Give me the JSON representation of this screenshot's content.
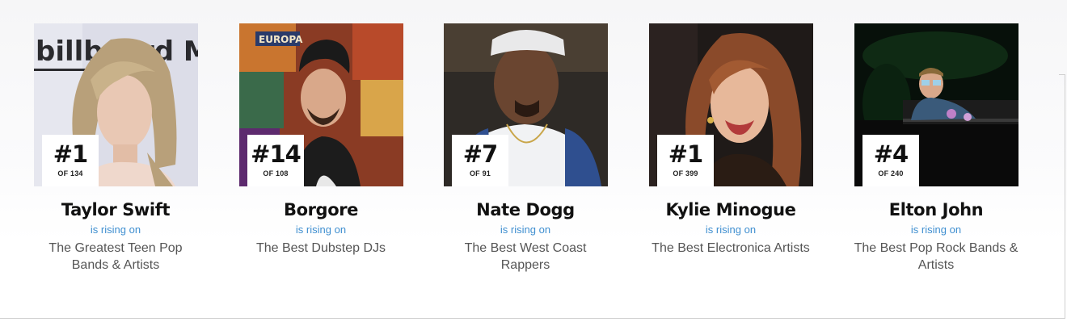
{
  "rising_label": "is rising on",
  "cards": [
    {
      "rank": "#1",
      "of_total": "OF 134",
      "name": "Taylor Swift",
      "list": "The Greatest Teen Pop Bands & Artists",
      "backdrop_text": "billboard MUSIC"
    },
    {
      "rank": "#14",
      "of_total": "OF 108",
      "name": "Borgore",
      "list": "The Best Dubstep DJs",
      "backdrop_text": "EUROPA"
    },
    {
      "rank": "#7",
      "of_total": "OF 91",
      "name": "Nate Dogg",
      "list": "The Best West Coast Rappers"
    },
    {
      "rank": "#1",
      "of_total": "OF 399",
      "name": "Kylie Minogue",
      "list": "The Best Electronica Artists"
    },
    {
      "rank": "#4",
      "of_total": "OF 240",
      "name": "Elton John",
      "list": "The Best Pop Rock Bands & Artists"
    }
  ],
  "colors": {
    "rising_blue": "#3f8fd0",
    "name_text": "#111111",
    "list_text": "#555555",
    "badge_bg": "#ffffff"
  }
}
